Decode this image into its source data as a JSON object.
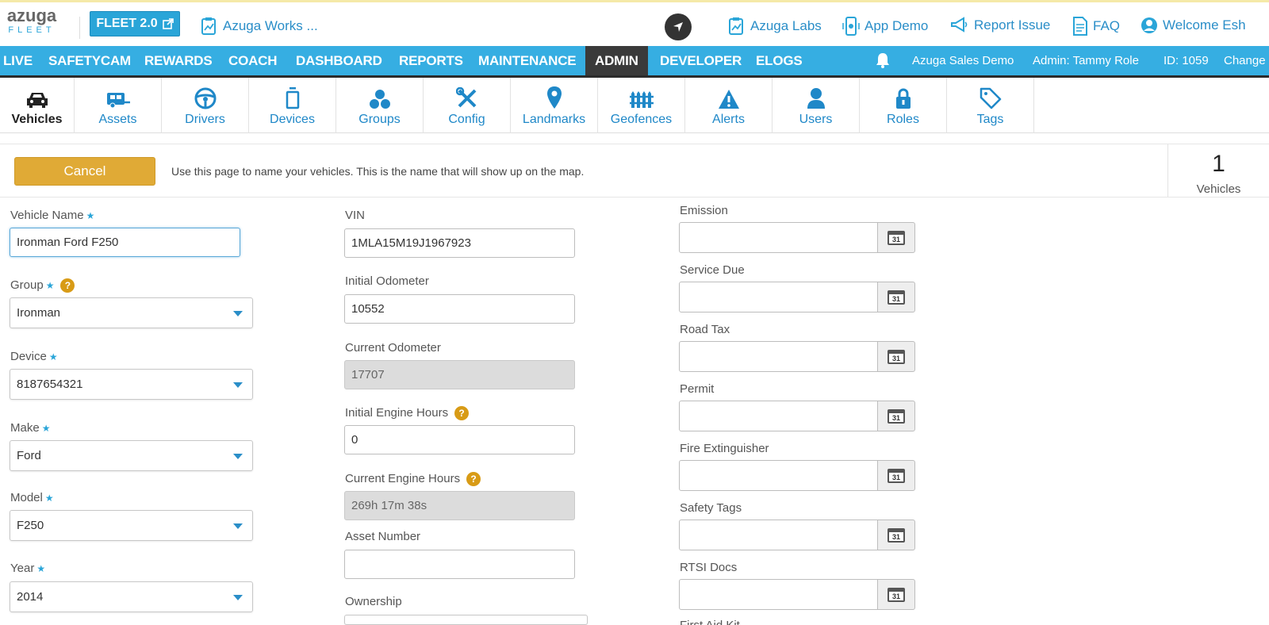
{
  "header": {
    "logo_word": "azuga",
    "logo_sub": "FLEET",
    "fleet_button": "FLEET 2.0",
    "works_link": "Azuga Works ...",
    "links": [
      {
        "label": "Azuga Labs",
        "icon": "clipboard-chart-icon"
      },
      {
        "label": "App Demo",
        "icon": "phone-icon"
      },
      {
        "label": "Report Issue",
        "icon": "megaphone-icon"
      },
      {
        "label": "FAQ",
        "icon": "document-icon"
      },
      {
        "label": "Welcome Esh",
        "icon": "user-circle-icon"
      }
    ]
  },
  "main_nav": {
    "items": [
      "Live",
      "SafetyCam",
      "Rewards",
      "Coach",
      "Dashboard",
      "Reports",
      "Maintenance",
      "Admin",
      "Developer",
      "ELogs"
    ],
    "active": "Admin",
    "account": "Azuga Sales Demo",
    "admin": "Admin: Tammy Role",
    "id": "ID: 1059",
    "change": "Change"
  },
  "sub_nav": {
    "tabs": [
      {
        "label": "Vehicles",
        "icon": "car-icon",
        "active": true
      },
      {
        "label": "Assets",
        "icon": "trailer-icon"
      },
      {
        "label": "Drivers",
        "icon": "steering-wheel-icon"
      },
      {
        "label": "Devices",
        "icon": "device-icon"
      },
      {
        "label": "Groups",
        "icon": "circles-icon"
      },
      {
        "label": "Config",
        "icon": "tools-icon"
      },
      {
        "label": "Landmarks",
        "icon": "map-pin-icon"
      },
      {
        "label": "Geofences",
        "icon": "fence-icon"
      },
      {
        "label": "Alerts",
        "icon": "warning-icon"
      },
      {
        "label": "Users",
        "icon": "user-icon"
      },
      {
        "label": "Roles",
        "icon": "lock-icon"
      },
      {
        "label": "Tags",
        "icon": "tag-icon"
      }
    ]
  },
  "infobar": {
    "cancel_label": "Cancel",
    "text": "Use this page to name your vehicles. This is the name that will show up on the map.",
    "count": "1",
    "count_label": "Vehicles"
  },
  "form": {
    "vehicle_name_label": "Vehicle Name",
    "vehicle_name": "Ironman Ford F250",
    "group_label": "Group",
    "group": "Ironman",
    "device_label": "Device",
    "device": "8187654321",
    "make_label": "Make",
    "make": "Ford",
    "model_label": "Model",
    "model": "F250",
    "year_label": "Year",
    "year": "2014",
    "vin_label": "VIN",
    "vin": "1MLA15M19J1967923",
    "initial_odometer_label": "Initial Odometer",
    "initial_odometer": "10552",
    "current_odometer_label": "Current Odometer",
    "current_odometer": "17707",
    "initial_engine_hours_label": "Initial Engine Hours",
    "initial_engine_hours": "0",
    "current_engine_hours_label": "Current Engine Hours",
    "current_engine_hours": "269h 17m 38s",
    "asset_number_label": "Asset Number",
    "asset_number": "",
    "ownership_label": "Ownership",
    "emission_label": "Emission",
    "service_due_label": "Service Due",
    "road_tax_label": "Road Tax",
    "permit_label": "Permit",
    "fire_extinguisher_label": "Fire Extinguisher",
    "safety_tags_label": "Safety Tags",
    "rtsi_docs_label": "RTSI Docs",
    "first_aid_kit_label": "First Aid Kit",
    "calendar_day": "31"
  },
  "colors": {
    "brand_blue": "#36aee2",
    "active_tab_dark": "#3a3a3a",
    "cancel_gold": "#e0aa36",
    "help_orange": "#d89b16"
  }
}
